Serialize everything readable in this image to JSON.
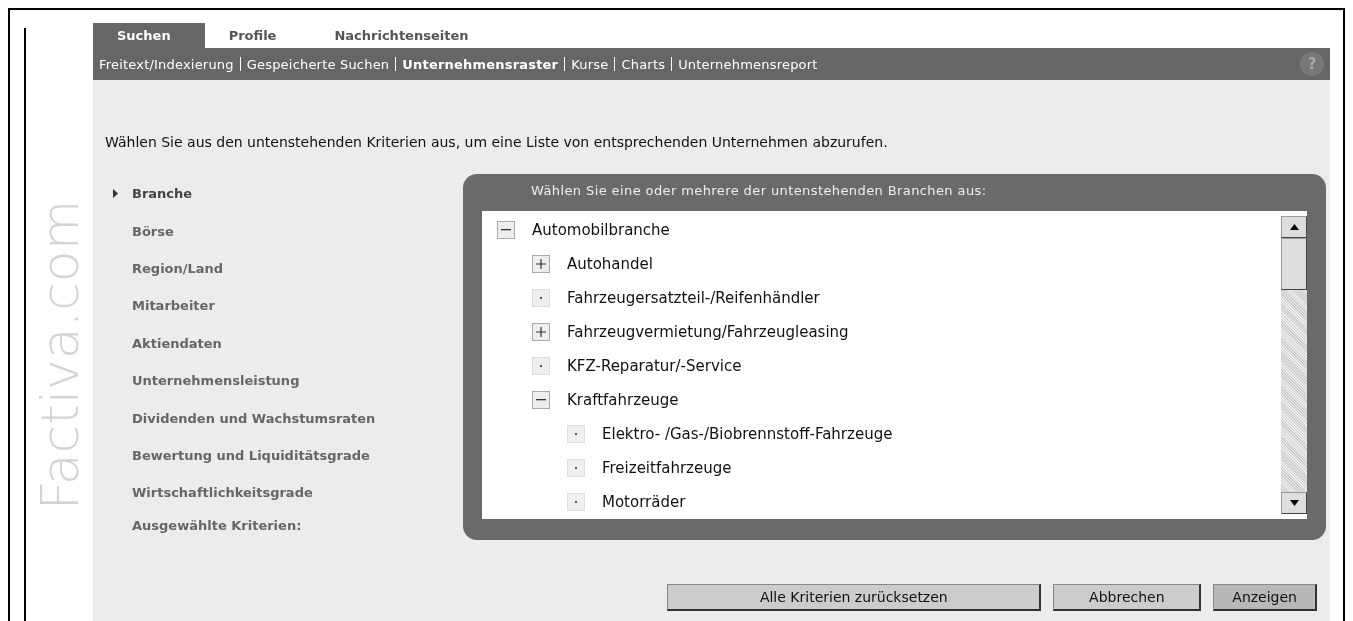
{
  "logo": "Factiva.com",
  "tabs": [
    {
      "label": "Suchen",
      "selected": true
    },
    {
      "label": "Profile",
      "selected": false
    },
    {
      "label": "Nachrichtenseiten",
      "selected": false
    }
  ],
  "subnav": [
    {
      "label": "Freitext/Indexierung",
      "selected": false
    },
    {
      "label": "Gespeicherte Suchen",
      "selected": false
    },
    {
      "label": "Unternehmensraster",
      "selected": true
    },
    {
      "label": "Kurse",
      "selected": false
    },
    {
      "label": "Charts",
      "selected": false
    },
    {
      "label": "Unternehmensreport",
      "selected": false
    }
  ],
  "help": "?",
  "intro": "Wählen Sie aus den untenstehenden Kriterien aus, um eine Liste von entsprechenden Unternehmen abzurufen.",
  "criteria": [
    {
      "label": "Branche",
      "selected": true
    },
    {
      "label": "Börse",
      "selected": false
    },
    {
      "label": "Region/Land",
      "selected": false
    },
    {
      "label": "Mitarbeiter",
      "selected": false
    },
    {
      "label": "Aktiendaten",
      "selected": false
    },
    {
      "label": "Unternehmensleistung",
      "selected": false
    },
    {
      "label": "Dividenden und Wachstumsraten",
      "selected": false
    },
    {
      "label": "Bewertung und Liquiditätsgrade",
      "selected": false
    },
    {
      "label": "Wirtschaftlichkeitsgrade",
      "selected": false
    }
  ],
  "selected_criteria_label": "Ausgewählte Kriterien:",
  "panel": {
    "title": "Wählen Sie eine oder mehrere der untenstehenden Branchen aus:",
    "tree": [
      {
        "label": "Automobilbranche",
        "kind": "branch",
        "expanded": true,
        "children": [
          {
            "label": "Autohandel",
            "kind": "branch",
            "expanded": false
          },
          {
            "label": "Fahrzeugersatzteil-/Reifenhändler",
            "kind": "leaf"
          },
          {
            "label": "Fahrzeugvermietung/Fahrzeugleasing",
            "kind": "branch",
            "expanded": false
          },
          {
            "label": "KFZ-Reparatur/-Service",
            "kind": "leaf"
          },
          {
            "label": "Kraftfahrzeuge",
            "kind": "branch",
            "expanded": true,
            "children": [
              {
                "label": "Elektro- /Gas-/Biobrennstoff-Fahrzeuge",
                "kind": "leaf"
              },
              {
                "label": "Freizeitfahrzeuge",
                "kind": "leaf"
              },
              {
                "label": "Motorräder",
                "kind": "leaf"
              }
            ]
          }
        ]
      }
    ]
  },
  "buttons": [
    {
      "label": "Alle Kriterien zurücksetzen",
      "kind": "secondary"
    },
    {
      "label": "Abbrechen",
      "kind": "secondary"
    },
    {
      "label": "Anzeigen",
      "kind": "primary"
    }
  ]
}
